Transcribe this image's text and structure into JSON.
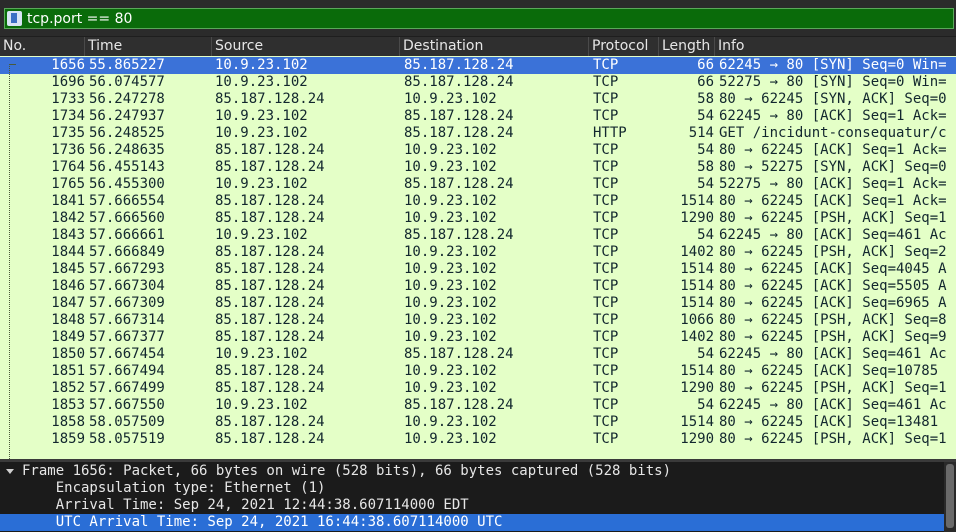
{
  "filter": {
    "value": "tcp.port == 80"
  },
  "columns": [
    "No.",
    "Time",
    "Source",
    "Destination",
    "Protocol",
    "Length",
    "Info"
  ],
  "packets": [
    {
      "no": "1656",
      "time": "55.865227",
      "src": "10.9.23.102",
      "dst": "85.187.128.24",
      "proto": "TCP",
      "len": "66",
      "info": "62245 → 80 [SYN] Seq=0 Win=",
      "selected": true
    },
    {
      "no": "1696",
      "time": "56.074577",
      "src": "10.9.23.102",
      "dst": "85.187.128.24",
      "proto": "TCP",
      "len": "66",
      "info": "52275 → 80 [SYN] Seq=0 Win="
    },
    {
      "no": "1733",
      "time": "56.247278",
      "src": "85.187.128.24",
      "dst": "10.9.23.102",
      "proto": "TCP",
      "len": "58",
      "info": "80 → 62245 [SYN, ACK] Seq=0"
    },
    {
      "no": "1734",
      "time": "56.247937",
      "src": "10.9.23.102",
      "dst": "85.187.128.24",
      "proto": "TCP",
      "len": "54",
      "info": "62245 → 80 [ACK] Seq=1 Ack="
    },
    {
      "no": "1735",
      "time": "56.248525",
      "src": "10.9.23.102",
      "dst": "85.187.128.24",
      "proto": "HTTP",
      "len": "514",
      "info": "GET /incidunt-consequatur/c"
    },
    {
      "no": "1736",
      "time": "56.248635",
      "src": "85.187.128.24",
      "dst": "10.9.23.102",
      "proto": "TCP",
      "len": "54",
      "info": "80 → 62245 [ACK] Seq=1 Ack="
    },
    {
      "no": "1764",
      "time": "56.455143",
      "src": "85.187.128.24",
      "dst": "10.9.23.102",
      "proto": "TCP",
      "len": "58",
      "info": "80 → 52275 [SYN, ACK] Seq=0"
    },
    {
      "no": "1765",
      "time": "56.455300",
      "src": "10.9.23.102",
      "dst": "85.187.128.24",
      "proto": "TCP",
      "len": "54",
      "info": "52275 → 80 [ACK] Seq=1 Ack="
    },
    {
      "no": "1841",
      "time": "57.666554",
      "src": "85.187.128.24",
      "dst": "10.9.23.102",
      "proto": "TCP",
      "len": "1514",
      "info": "80 → 62245 [ACK] Seq=1 Ack="
    },
    {
      "no": "1842",
      "time": "57.666560",
      "src": "85.187.128.24",
      "dst": "10.9.23.102",
      "proto": "TCP",
      "len": "1290",
      "info": "80 → 62245 [PSH, ACK] Seq=1"
    },
    {
      "no": "1843",
      "time": "57.666661",
      "src": "10.9.23.102",
      "dst": "85.187.128.24",
      "proto": "TCP",
      "len": "54",
      "info": "62245 → 80 [ACK] Seq=461 Ac"
    },
    {
      "no": "1844",
      "time": "57.666849",
      "src": "85.187.128.24",
      "dst": "10.9.23.102",
      "proto": "TCP",
      "len": "1402",
      "info": "80 → 62245 [PSH, ACK] Seq=2"
    },
    {
      "no": "1845",
      "time": "57.667293",
      "src": "85.187.128.24",
      "dst": "10.9.23.102",
      "proto": "TCP",
      "len": "1514",
      "info": "80 → 62245 [ACK] Seq=4045 A"
    },
    {
      "no": "1846",
      "time": "57.667304",
      "src": "85.187.128.24",
      "dst": "10.9.23.102",
      "proto": "TCP",
      "len": "1514",
      "info": "80 → 62245 [ACK] Seq=5505 A"
    },
    {
      "no": "1847",
      "time": "57.667309",
      "src": "85.187.128.24",
      "dst": "10.9.23.102",
      "proto": "TCP",
      "len": "1514",
      "info": "80 → 62245 [ACK] Seq=6965 A"
    },
    {
      "no": "1848",
      "time": "57.667314",
      "src": "85.187.128.24",
      "dst": "10.9.23.102",
      "proto": "TCP",
      "len": "1066",
      "info": "80 → 62245 [PSH, ACK] Seq=8"
    },
    {
      "no": "1849",
      "time": "57.667377",
      "src": "85.187.128.24",
      "dst": "10.9.23.102",
      "proto": "TCP",
      "len": "1402",
      "info": "80 → 62245 [PSH, ACK] Seq=9"
    },
    {
      "no": "1850",
      "time": "57.667454",
      "src": "10.9.23.102",
      "dst": "85.187.128.24",
      "proto": "TCP",
      "len": "54",
      "info": "62245 → 80 [ACK] Seq=461 Ac"
    },
    {
      "no": "1851",
      "time": "57.667494",
      "src": "85.187.128.24",
      "dst": "10.9.23.102",
      "proto": "TCP",
      "len": "1514",
      "info": "80 → 62245 [ACK] Seq=10785"
    },
    {
      "no": "1852",
      "time": "57.667499",
      "src": "85.187.128.24",
      "dst": "10.9.23.102",
      "proto": "TCP",
      "len": "1290",
      "info": "80 → 62245 [PSH, ACK] Seq=1"
    },
    {
      "no": "1853",
      "time": "57.667550",
      "src": "10.9.23.102",
      "dst": "85.187.128.24",
      "proto": "TCP",
      "len": "54",
      "info": "62245 → 80 [ACK] Seq=461 Ac"
    },
    {
      "no": "1858",
      "time": "58.057509",
      "src": "85.187.128.24",
      "dst": "10.9.23.102",
      "proto": "TCP",
      "len": "1514",
      "info": "80 → 62245 [ACK] Seq=13481"
    },
    {
      "no": "1859",
      "time": "58.057519",
      "src": "85.187.128.24",
      "dst": "10.9.23.102",
      "proto": "TCP",
      "len": "1290",
      "info": "80 → 62245 [PSH, ACK] Seq=1"
    }
  ],
  "details": [
    {
      "text": "Frame 1656: Packet, 66 bytes on wire (528 bits), 66 bytes captured (528 bits)",
      "expander": true
    },
    {
      "text": "    Encapsulation type: Ethernet (1)"
    },
    {
      "text": "    Arrival Time: Sep 24, 2021 12:44:38.607114000 EDT"
    },
    {
      "text": "    UTC Arrival Time: Sep 24, 2021 16:44:38.607114000 UTC",
      "selected": true
    }
  ],
  "colors": {
    "filter_valid": "#0a6b0a",
    "row_tcp": "#e4ffc7",
    "row_selected": "#3b72d8"
  }
}
